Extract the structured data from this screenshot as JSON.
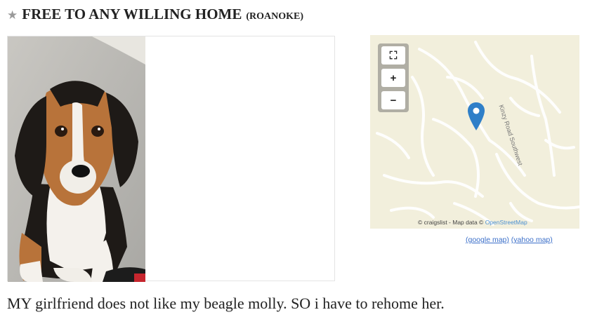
{
  "posting": {
    "star_icon": "star-icon",
    "title": "FREE TO ANY WILLING HOME",
    "location": "(ROANOKE)",
    "body": "MY girlfriend does not like my beagle molly. SO i have to rehome her."
  },
  "map": {
    "controls": [
      {
        "icon": "fullscreen-icon",
        "glyph": "⛶"
      },
      {
        "icon": "zoom-in-icon",
        "glyph": "+"
      },
      {
        "icon": "zoom-out-icon",
        "glyph": "−"
      }
    ],
    "road_label": "Kinzy Road Southwest",
    "attribution_prefix": "© craigslist - Map data ©",
    "attribution_link": "OpenStreetMap",
    "google_link": "(google map)",
    "yahoo_link": "(yahoo map)"
  },
  "colors": {
    "map_background": "#f2efdc",
    "pin": "#2f7fc8",
    "link": "#3b6fc9"
  }
}
